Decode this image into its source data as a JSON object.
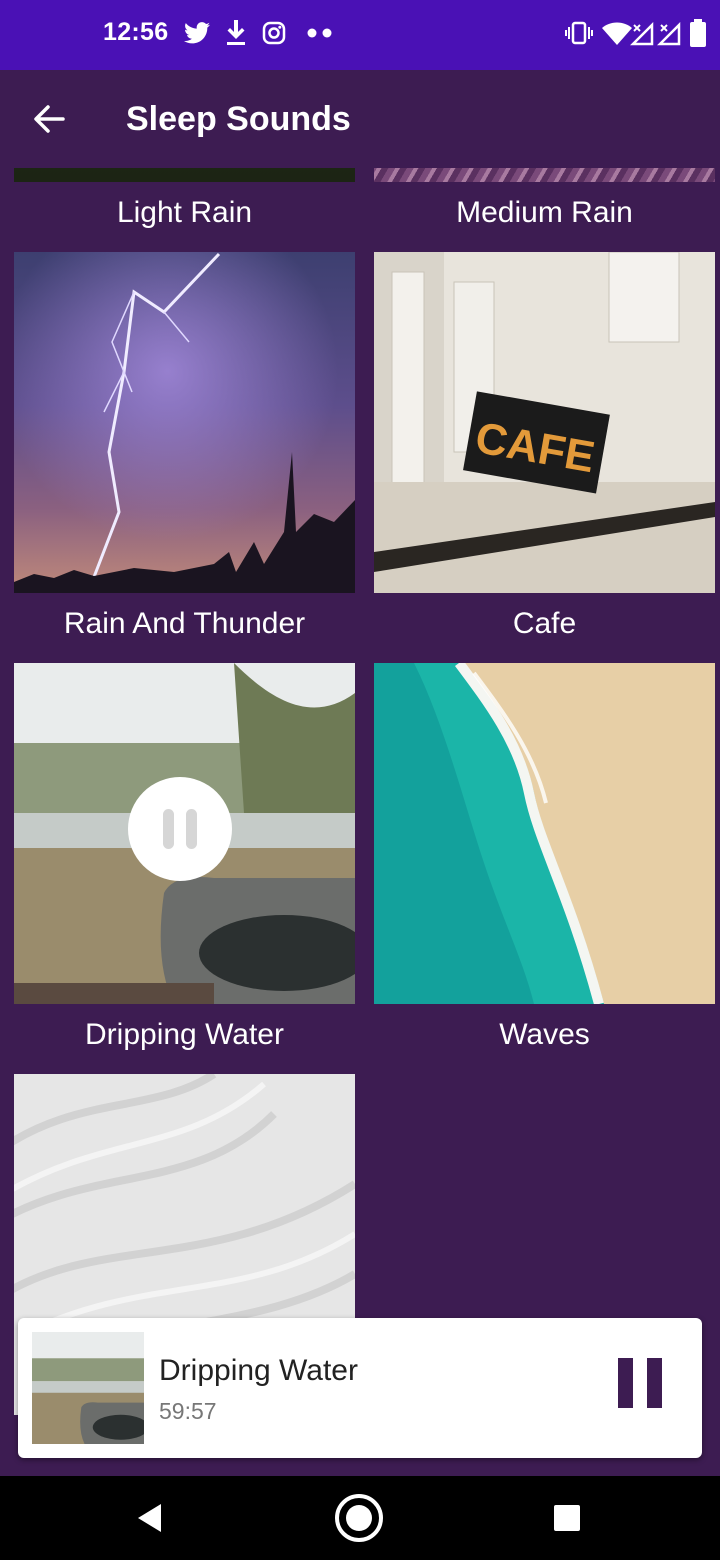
{
  "status_bar": {
    "time": "12:56"
  },
  "appbar": {
    "title": "Sleep Sounds"
  },
  "sounds": [
    {
      "label": "Light Rain"
    },
    {
      "label": "Medium Rain"
    },
    {
      "label": "Rain And Thunder"
    },
    {
      "label": "Cafe",
      "sign_text": "CAFE"
    },
    {
      "label": "Dripping Water",
      "playing": true
    },
    {
      "label": "Waves"
    },
    {
      "label": ""
    }
  ],
  "player": {
    "title": "Dripping Water",
    "remaining": "59:57"
  },
  "colors": {
    "background": "#3d1c52",
    "status_bar": "#4a11b5",
    "nav_bar": "#000000",
    "accent": "#3d1c52"
  }
}
